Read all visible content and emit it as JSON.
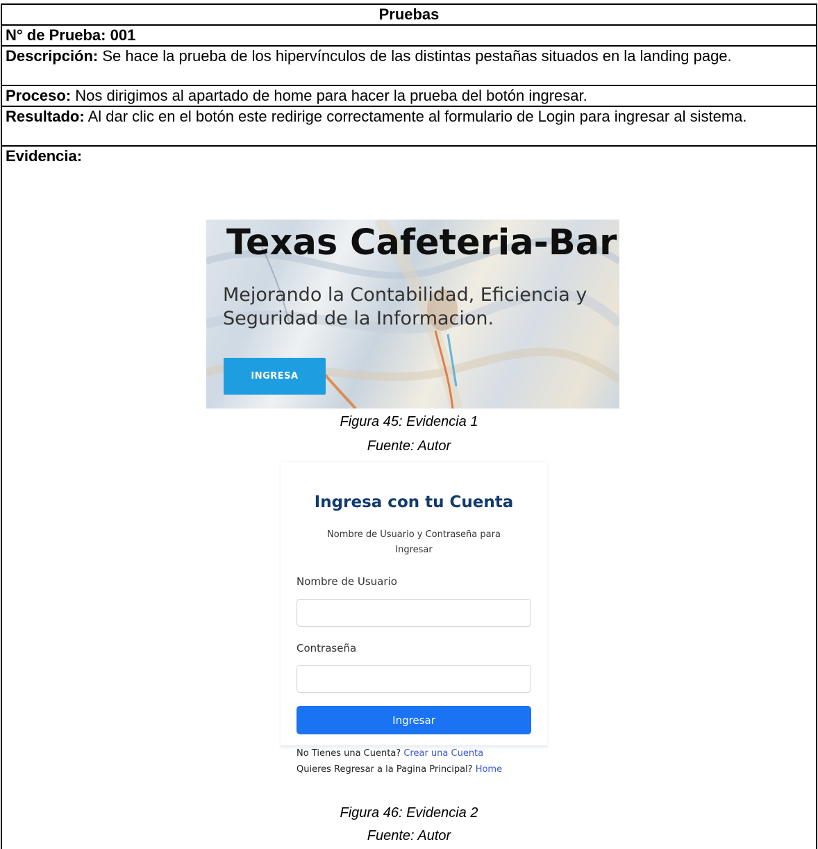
{
  "table": {
    "title": "Pruebas",
    "test_number": "N° de Prueba: 001",
    "description_label": "Descripción:",
    "description_text": " Se hace la prueba de los hipervínculos de las distintas pestañas situados en la landing page.",
    "process_label": "Proceso:",
    "process_text": " Nos dirigimos al apartado de home para hacer la prueba del botón ingresar.",
    "result_label": "Resultado:",
    "result_text": " Al dar clic en el botón este redirige correctamente al formulario de Login para ingresar al sistema.",
    "evidence_label": "Evidencia:"
  },
  "figure1": {
    "hero_title": "Texas Cafeteria-Bar",
    "hero_subtitle_line1": "Mejorando la Contabilidad, Eficiencia y",
    "hero_subtitle_line2": "Seguridad de la Informacion.",
    "button_label": "INGRESA",
    "caption": "Figura 45: Evidencia 1",
    "source": "Fuente: Autor"
  },
  "figure2": {
    "title": "Ingresa con tu Cuenta",
    "subtitle": "Nombre de Usuario y Contraseña para Ingresar",
    "username_label": "Nombre de Usuario",
    "username_value": "",
    "password_label": "Contraseña",
    "password_value": "",
    "submit_label": "Ingresar",
    "no_account_text": "No Tienes una Cuenta? ",
    "create_account_link": "Crear una Cuenta",
    "back_text": "Quieres Regresar a la Pagina Principal? ",
    "home_link": "Home",
    "caption": "Figura 46: Evidencia 2",
    "source": "Fuente: Autor"
  },
  "colors": {
    "hero_button": "#1e9ee0",
    "login_title": "#123a6e",
    "login_button": "#1a73f3",
    "link": "#3a57d6"
  }
}
